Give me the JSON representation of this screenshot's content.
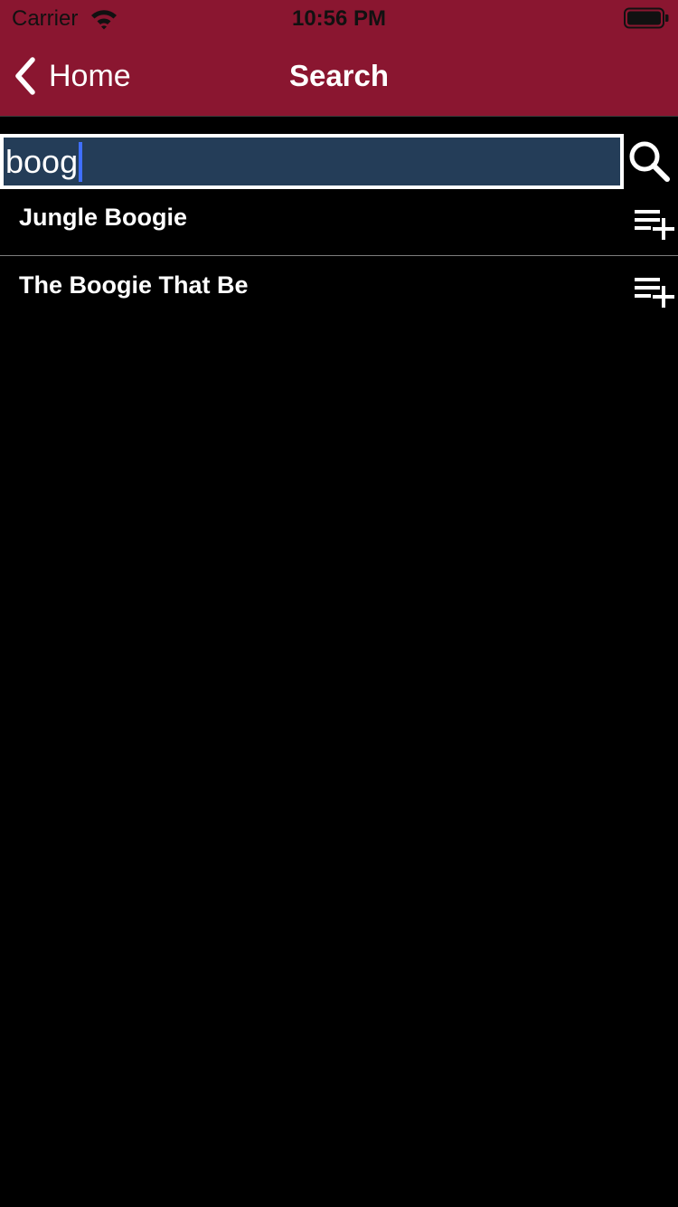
{
  "status_bar": {
    "carrier": "Carrier",
    "time": "10:56 PM",
    "icons": [
      "wifi-icon",
      "battery-icon"
    ]
  },
  "nav": {
    "back_label": "Home",
    "title": "Search",
    "background": "#8a1630"
  },
  "search": {
    "value": "boog",
    "field_background": "#243d58",
    "caret_color": "#3f6fff",
    "button_icon": "search-icon"
  },
  "results": [
    {
      "title": "Jungle Boogie",
      "action_icon": "add-to-queue-icon"
    },
    {
      "title": "The Boogie That Be",
      "action_icon": "add-to-queue-icon"
    }
  ]
}
